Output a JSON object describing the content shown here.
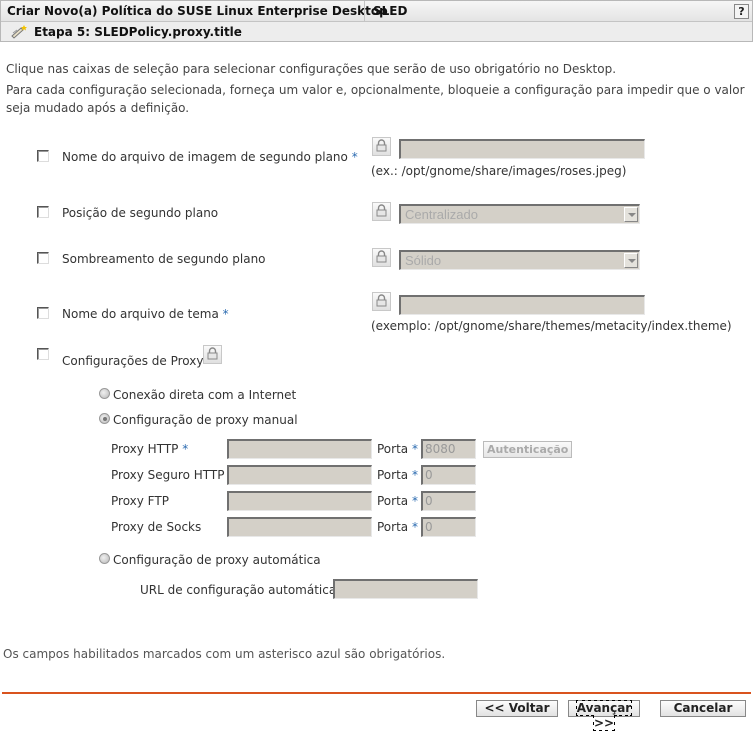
{
  "header": {
    "title": "Criar Novo(a) Política do SUSE Linux Enterprise Desktop",
    "product": "SLED",
    "help_label": "?",
    "step_icon": "wizard-wand-icon",
    "step_title": "Etapa 5: SLEDPolicy.proxy.title"
  },
  "intro": {
    "line1": "Clique nas caixas de seleção para selecionar configurações que serão de uso obrigatório no Desktop.",
    "line2": "Para cada configuração selecionada, forneça um valor e, opcionalmente, bloqueie a configuração para impedir que o valor",
    "line3": "seja mudado após a definição."
  },
  "settings": {
    "wallpaper_file": {
      "label": "Nome do arquivo de imagem de segundo plano",
      "required": "*",
      "value": "",
      "hint": "(ex.: /opt/gnome/share/images/roses.jpeg)",
      "checked": false
    },
    "wallpaper_position": {
      "label": "Posição de segundo plano",
      "selected": "Centralizado",
      "checked": false
    },
    "wallpaper_shading": {
      "label": "Sombreamento de segundo plano",
      "selected": "Sólido",
      "checked": false
    },
    "theme_file": {
      "label": "Nome do arquivo de tema",
      "required": "*",
      "value": "",
      "hint": "(exemplo: /opt/gnome/share/themes/metacity/index.theme)",
      "checked": false
    },
    "proxy": {
      "label": "Configurações de Proxy",
      "checked": false,
      "options": {
        "direct": "Conexão direta com a Internet",
        "manual": "Configuração de proxy manual",
        "auto": "Configuração de proxy automática"
      },
      "selected_option": "manual",
      "port_label": "Porta",
      "required": "*",
      "auth_button": "Autenticação",
      "rows": [
        {
          "label": "Proxy HTTP",
          "required": "*",
          "host": "",
          "port": "8080"
        },
        {
          "label": "Proxy Seguro HTTP",
          "required": "",
          "host": "",
          "port": "0"
        },
        {
          "label": "Proxy FTP",
          "required": "",
          "host": "",
          "port": "0"
        },
        {
          "label": "Proxy de Socks",
          "required": "",
          "host": "",
          "port": "0"
        }
      ],
      "auto_url_label": "URL de configuração automática",
      "auto_url_value": ""
    }
  },
  "footer": {
    "note": "Os campos habilitados marcados com um asterisco azul são obrigatórios.",
    "back": "<< Voltar",
    "next": "Avançar >>",
    "cancel": "Cancelar",
    "accent_color": "#d9531e"
  }
}
